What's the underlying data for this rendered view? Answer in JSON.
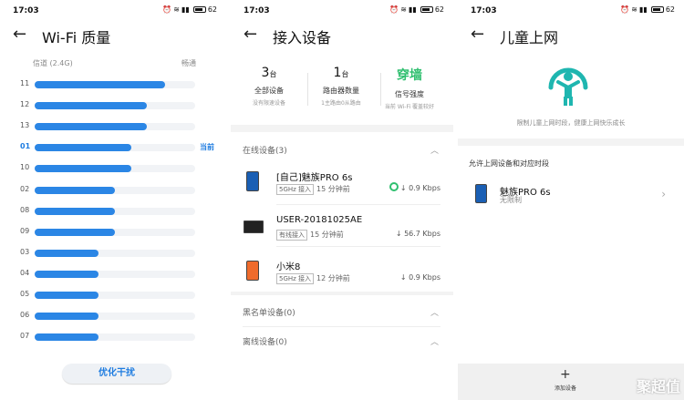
{
  "status": {
    "time": "17:03",
    "battery": "62"
  },
  "p1": {
    "title": "Wi-Fi 质量",
    "channel_label": "信道 (2.4G)",
    "quality_label": "畅通",
    "current_label": "当前",
    "channels": [
      {
        "num": "11",
        "level": 0.81
      },
      {
        "num": "12",
        "level": 0.7
      },
      {
        "num": "13",
        "level": 0.7
      },
      {
        "num": "01",
        "level": 0.6
      },
      {
        "num": "10",
        "level": 0.6
      },
      {
        "num": "02",
        "level": 0.5
      },
      {
        "num": "08",
        "level": 0.5
      },
      {
        "num": "09",
        "level": 0.5
      },
      {
        "num": "03",
        "level": 0.4
      },
      {
        "num": "04",
        "level": 0.4
      },
      {
        "num": "05",
        "level": 0.4
      },
      {
        "num": "06",
        "level": 0.4
      },
      {
        "num": "07",
        "level": 0.4
      }
    ],
    "optimize_button": "优化干扰"
  },
  "p2": {
    "title": "接入设备",
    "stats": [
      {
        "value": "3",
        "unit": "台",
        "label": "全部设备",
        "sub": "没有限速设备"
      },
      {
        "value": "1",
        "unit": "台",
        "label": "路由器数量",
        "sub": "1主路由0从路由"
      },
      {
        "value": "穿墙",
        "unit": "",
        "label": "信号强度",
        "sub": "当前 Wi-Fi 覆盖较好"
      }
    ],
    "online_header": "在线设备(3)",
    "devices": [
      {
        "name": "[自己]魅族PRO 6s",
        "tag": "5GHz 接入",
        "time": "15 分钟前",
        "speed": "↓ 0.9 Kbps"
      },
      {
        "name": "USER-20181025AE",
        "tag": "有线接入",
        "time": "15 分钟前",
        "speed": "↓ 56.7 Kbps"
      },
      {
        "name": "小米8",
        "tag": "5GHz 接入",
        "time": "12 分钟前",
        "speed": "↓ 0.9 Kbps"
      }
    ],
    "blacklist_header": "黑名单设备(0)",
    "offline_header": "离线设备(0)"
  },
  "p3": {
    "title": "儿童上网",
    "desc": "限制儿童上网时段，健康上网快乐成长",
    "allow_header": "允许上网设备和对应时段",
    "device_name": "魅族PRO 6s",
    "device_sub": "无限制",
    "add_label": "添加设备",
    "watermark": "聚超值"
  },
  "colors": {
    "accent": "#2b86e5",
    "green": "#2fbf6f",
    "teal": "#1fb6b0"
  }
}
